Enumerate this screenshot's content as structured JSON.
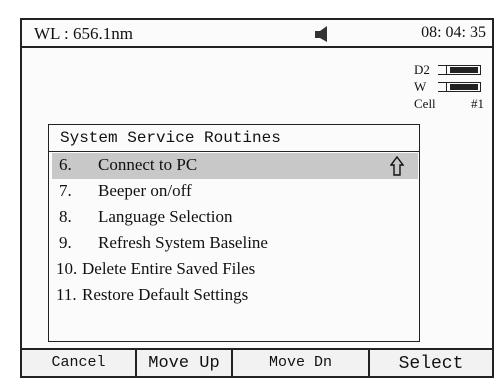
{
  "status": {
    "wavelength": "WL :  656.1nm",
    "clock": "08: 04: 35",
    "speaker_icon": "speaker-icon"
  },
  "lamps": {
    "d2_label": "D2",
    "w_label": "W",
    "cell_label": "Cell",
    "cell_number": "#1"
  },
  "dialog": {
    "title": "System Service Routines",
    "items": [
      {
        "num": "6.",
        "label": "Connect to PC"
      },
      {
        "num": "7.",
        "label": "Beeper on/off"
      },
      {
        "num": "8.",
        "label": "Language Selection"
      },
      {
        "num": "9.",
        "label": "Refresh System Baseline"
      },
      {
        "num": "10.",
        "label": "Delete Entire Saved Files"
      },
      {
        "num": "11.",
        "label": "Restore Default Settings"
      }
    ],
    "selected_index": 0,
    "selected_marker_icon": "up-arrow-icon"
  },
  "softkeys": {
    "cancel": "Cancel",
    "move_up": "Move Up",
    "move_dn": "Move Dn",
    "select": "Select"
  }
}
